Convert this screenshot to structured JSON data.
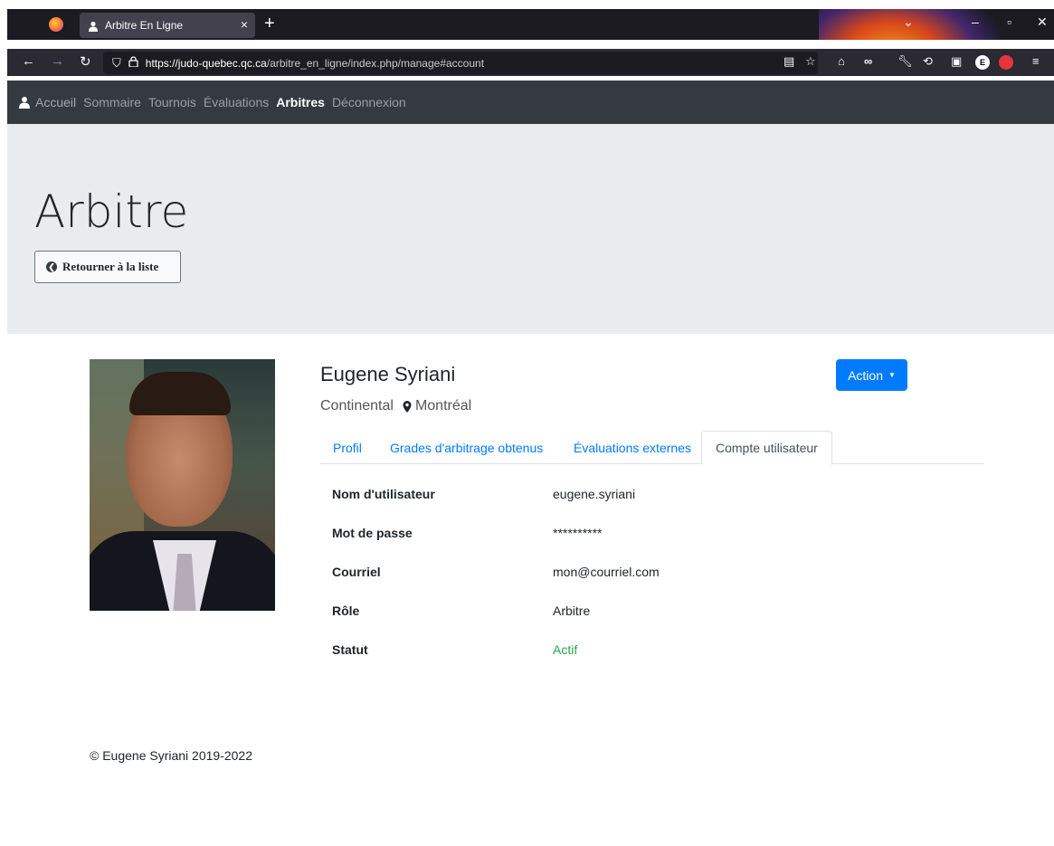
{
  "browser": {
    "tab_title": "Arbitre En Ligne",
    "tab_close": "×",
    "new_tab": "+",
    "url_domain": "https://judo-quebec.qc.ca",
    "url_path": "/arbitre_en_ligne/index.php/manage#account",
    "ext_badge_e": "E"
  },
  "site_nav": {
    "brand": "Accueil",
    "links": [
      "Sommaire",
      "Tournois",
      "Évaluations",
      "Arbitres",
      "Déconnexion"
    ],
    "active_link": "Arbitres"
  },
  "jumbotron": {
    "title": "Arbitre",
    "back_button": "Retourner à la liste"
  },
  "profile": {
    "name": "Eugene Syriani",
    "level": "Continental",
    "city": "Montréal",
    "action_button": "Action"
  },
  "tabs": [
    {
      "label": "Profil",
      "active": false
    },
    {
      "label": "Grades d'arbitrage obtenus",
      "active": false
    },
    {
      "label": "Évaluations externes",
      "active": false
    },
    {
      "label": "Compte utilisateur",
      "active": true
    }
  ],
  "account": {
    "rows": [
      {
        "label": "Nom d'utilisateur",
        "value": "eugene.syriani"
      },
      {
        "label": "Mot de passe",
        "value": "**********"
      },
      {
        "label": "Courriel",
        "value": "mon@courriel.com"
      },
      {
        "label": "Rôle",
        "value": "Arbitre"
      },
      {
        "label": "Statut",
        "value": "Actif"
      }
    ]
  },
  "footer": {
    "text": "© Eugene Syriani 2019-2022"
  },
  "colors": {
    "primary": "#007bff",
    "status_active": "#28a745",
    "navbar": "#343a40",
    "jumbotron": "#e9ecef"
  },
  "icons": [
    "firefox-icon",
    "person-icon",
    "back-arrow-icon",
    "forward-arrow-icon",
    "reload-icon",
    "shield-icon",
    "lock-icon",
    "reader-view-icon",
    "bookmark-star-icon",
    "home-icon",
    "map-pin-icon",
    "circle-arrow-left-icon",
    "caret-down-icon"
  ]
}
